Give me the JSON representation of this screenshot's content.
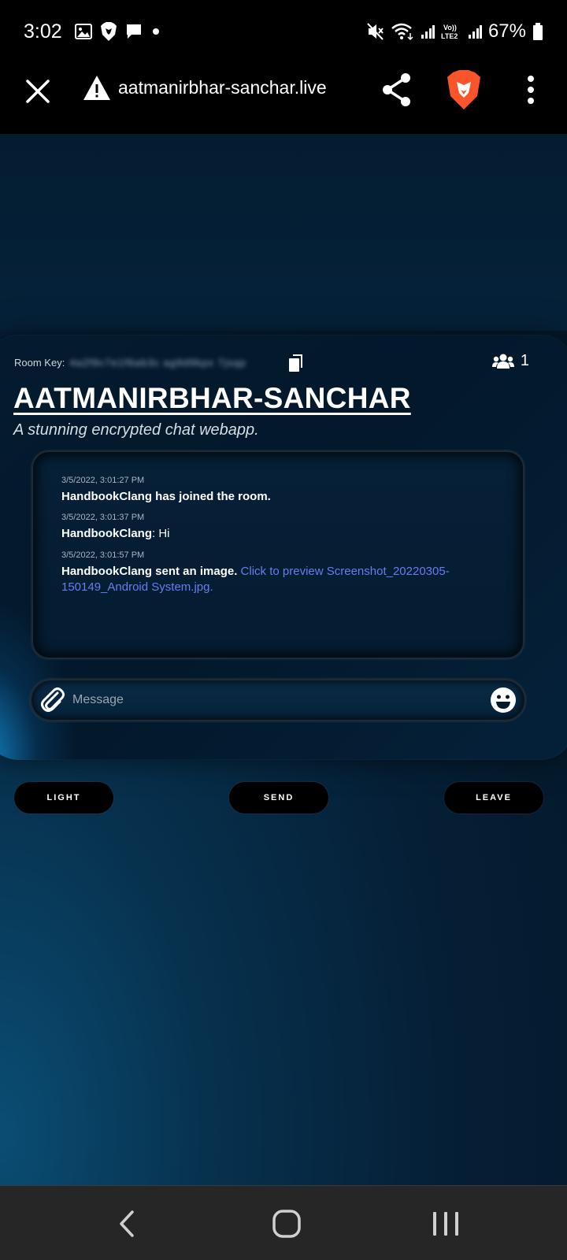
{
  "status_bar": {
    "time": "3:02",
    "battery": "67%",
    "icons_left": [
      "image-icon",
      "brave-notification-icon",
      "message-icon",
      "dot-icon"
    ],
    "icons_right": [
      "mute-icon",
      "wifi-icon",
      "signal-icon",
      "volte-icon",
      "signal-icon",
      "battery-icon"
    ],
    "volte_label": "Vo)) LTE2"
  },
  "browser": {
    "url": "aatmanirbhar-sanchar.live",
    "brave_color": "#fb542b"
  },
  "room": {
    "key_label": "Room Key:",
    "key_value": "4a2f9c7e1f6ab3c ag9d9kpx 7jsqp",
    "users_count": "1",
    "title": "AATMANIRBHAR-SANCHAR",
    "subtitle": "A stunning encrypted chat webapp."
  },
  "messages": [
    {
      "time": "3/5/2022, 3:01:27 PM",
      "user": "HandbookClang has joined the room.",
      "text": "",
      "link": ""
    },
    {
      "time": "3/5/2022, 3:01:37 PM",
      "user": "HandbookClang",
      "text": ": Hi",
      "link": ""
    },
    {
      "time": "3/5/2022, 3:01:57 PM",
      "user": "HandbookClang sent an image.",
      "text": " ",
      "link": "Click to preview Screenshot_20220305-150149_Android System.jpg."
    }
  ],
  "composer": {
    "placeholder": "Message"
  },
  "buttons": {
    "light": "LIGHT",
    "send": "SEND",
    "leave": "LEAVE"
  },
  "colors": {
    "link": "#6a7cf0",
    "accent": "#0a4d74"
  }
}
